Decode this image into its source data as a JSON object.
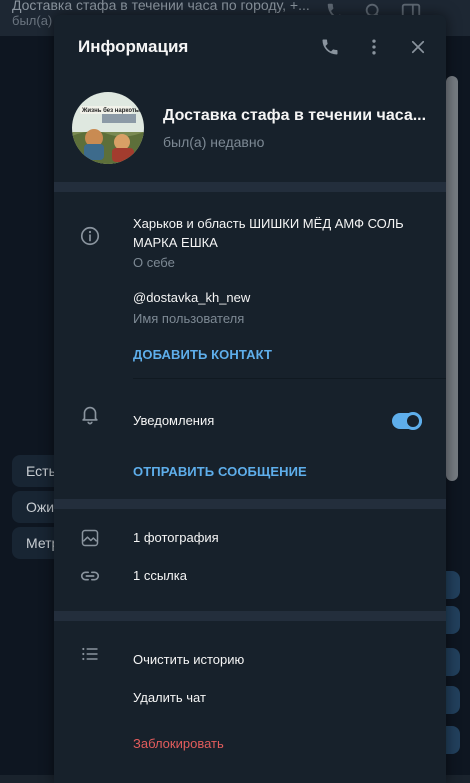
{
  "background": {
    "chat_title": "Доставка стафа в течении часа по городу, +...",
    "chat_status": "был(а) ...",
    "bubbles": [
      "Есть",
      "Ожид",
      "Метр"
    ]
  },
  "dialog": {
    "title": "Информация",
    "header_icons": [
      "phone-icon",
      "more-vertical-icon",
      "close-icon"
    ]
  },
  "profile": {
    "name": "Доставка стафа в течении часа...",
    "status": "был(а) недавно",
    "avatar_caption": "Жизнь без наркоты"
  },
  "info": {
    "bio": "Харьков и область ШИШКИ МЁД АМФ СОЛЬ МАРКА ЕШКА",
    "bio_label": "О себе",
    "username": "@dostavka_kh_new",
    "username_label": "Имя пользователя",
    "add_contact": "ДОБАВИТЬ КОНТАКТ",
    "notifications": "Уведомления",
    "notifications_on": true,
    "send_message": "ОТПРАВИТЬ СООБЩЕНИЕ"
  },
  "media": {
    "photos": "1 фотография",
    "links": "1 ссылка"
  },
  "actions": {
    "clear_history": "Очистить историю",
    "delete_chat": "Удалить чат",
    "block": "Заблокировать"
  },
  "colors": {
    "accent": "#5eaeeb",
    "danger": "#e25c5c",
    "panel": "#17212b",
    "separator": "#232e3c"
  }
}
